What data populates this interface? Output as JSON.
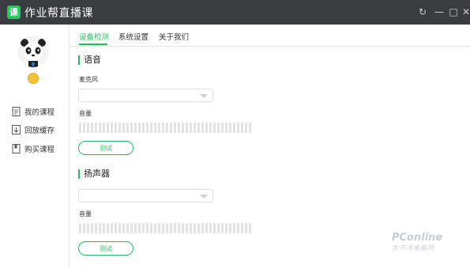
{
  "app": {
    "title": "作业帮直播课",
    "logo_char": "课"
  },
  "window_controls": {
    "refresh": "↻",
    "minimize": "—",
    "maximize": "□",
    "close": "✕"
  },
  "sidebar": {
    "items": [
      {
        "label": "我的课程",
        "icon": "document-icon"
      },
      {
        "label": "回放缓存",
        "icon": "download-icon"
      },
      {
        "label": "购买课程",
        "icon": "book-icon"
      }
    ]
  },
  "tabs": [
    {
      "label": "设备检测",
      "active": true
    },
    {
      "label": "系统设置",
      "active": false
    },
    {
      "label": "关于我们",
      "active": false
    }
  ],
  "voice": {
    "title": "语音",
    "mic_label": "麦克风",
    "mic_selected": "",
    "volume_label": "音量",
    "test_label": "测试"
  },
  "speaker": {
    "title": "扬声器",
    "speaker_selected": "",
    "volume_label": "音量",
    "test_label": "测试"
  },
  "watermark": {
    "main": "PConline",
    "sub": "太平洋电脑网"
  },
  "colors": {
    "accent": "#1fbf5a",
    "titlebar": "#3a3d40"
  }
}
